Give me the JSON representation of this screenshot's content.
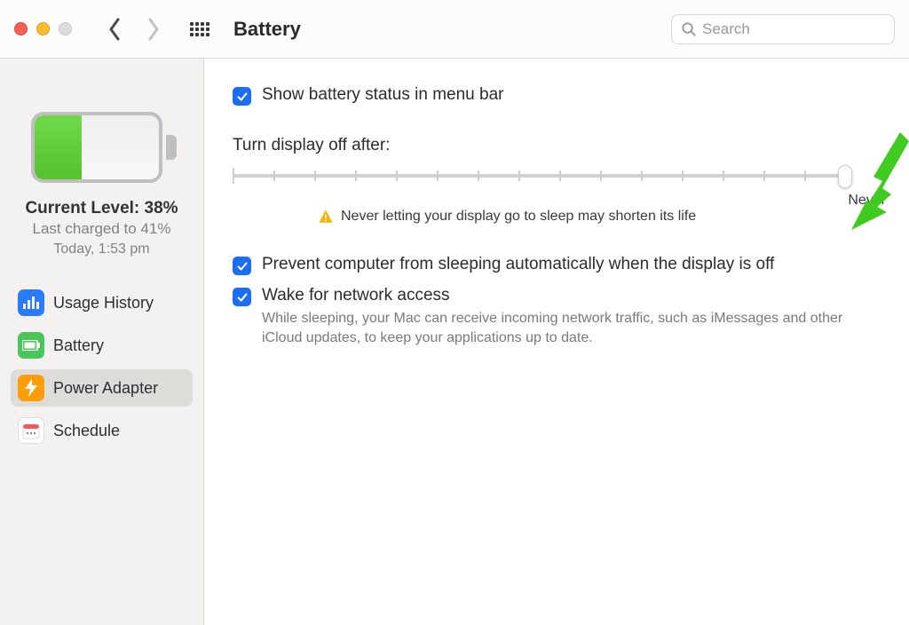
{
  "toolbar": {
    "title": "Battery",
    "search_placeholder": "Search"
  },
  "sidebar": {
    "current_level_label": "Current Level: 38%",
    "last_charged_label": "Last charged to 41%",
    "last_charged_when": "Today, 1:53 pm",
    "battery_fill_percent": 38,
    "items": [
      {
        "label": "Usage History",
        "icon": "usage-history-icon",
        "selected": false
      },
      {
        "label": "Battery",
        "icon": "battery-icon",
        "selected": false
      },
      {
        "label": "Power Adapter",
        "icon": "power-adapter-icon",
        "selected": true
      },
      {
        "label": "Schedule",
        "icon": "schedule-icon",
        "selected": false
      }
    ]
  },
  "main": {
    "show_status_label": "Show battery status in menu bar",
    "show_status_checked": true,
    "turn_display_off_label": "Turn display off after:",
    "slider_value_label": "Never",
    "slider_position_percent": 100,
    "warning_text": "Never letting your display go to sleep may shorten its life",
    "prevent_sleep_label": "Prevent computer from sleeping automatically when the display is off",
    "prevent_sleep_checked": true,
    "wake_network_label": "Wake for network access",
    "wake_network_checked": true,
    "wake_network_desc": "While sleeping, your Mac can receive incoming network traffic, such as iMessages and other iCloud updates, to keep your applications up to date."
  },
  "annotation": {
    "arrow_color": "#3fcb1f"
  }
}
